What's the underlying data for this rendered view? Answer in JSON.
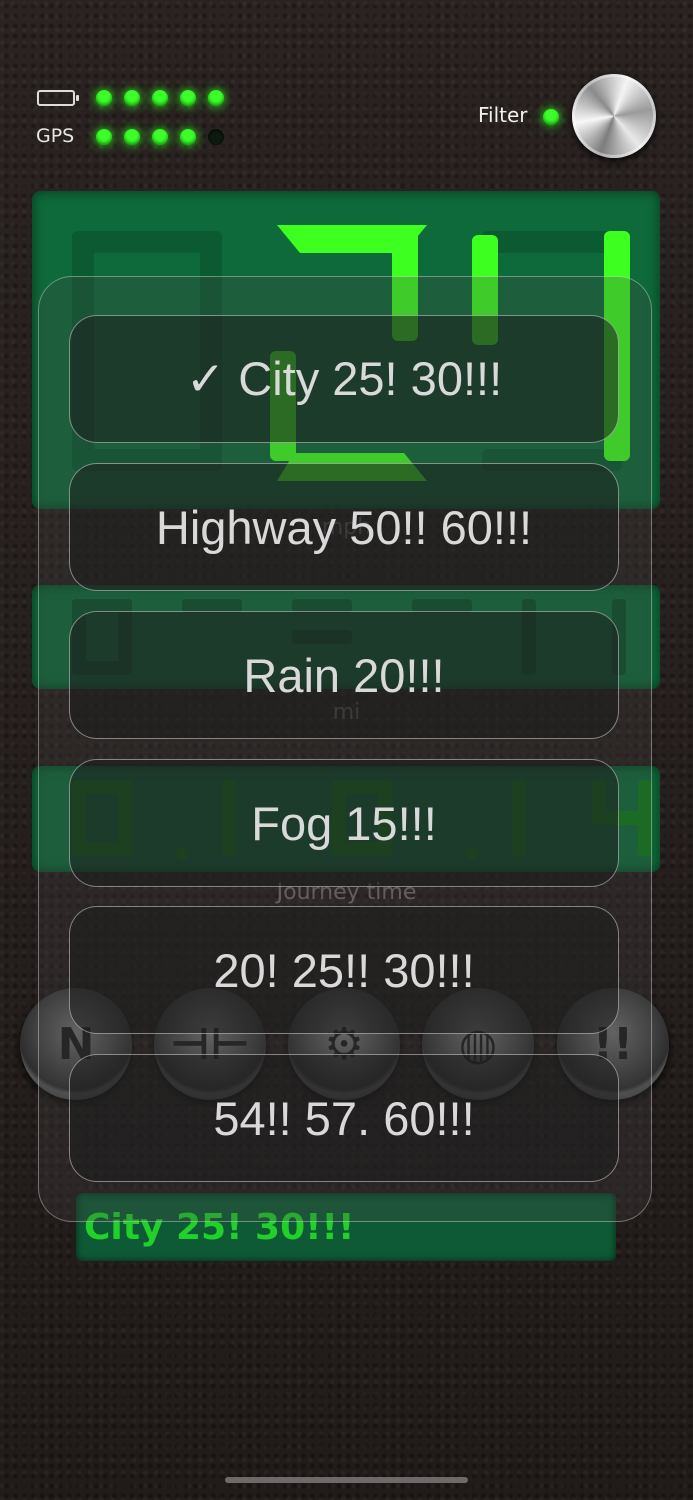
{
  "status": {
    "gps_label": "GPS",
    "filter_label": "Filter",
    "battery_leds": [
      true,
      true,
      true,
      true,
      true
    ],
    "gps_leds": [
      true,
      true,
      true,
      true,
      false
    ],
    "filter_led": true
  },
  "display": {
    "speed_unit": "mph",
    "distance_unit": "mi",
    "journey_label": "Journey time"
  },
  "buttons": {
    "warning_label": "!!"
  },
  "current_mode": "City 25! 30!!!",
  "picker": {
    "options": [
      "✓ City 25! 30!!!",
      "Highway 50!! 60!!!",
      "Rain 20!!!",
      "Fog 15!!!",
      "20! 25!! 30!!!",
      "54!! 57. 60!!!"
    ]
  }
}
